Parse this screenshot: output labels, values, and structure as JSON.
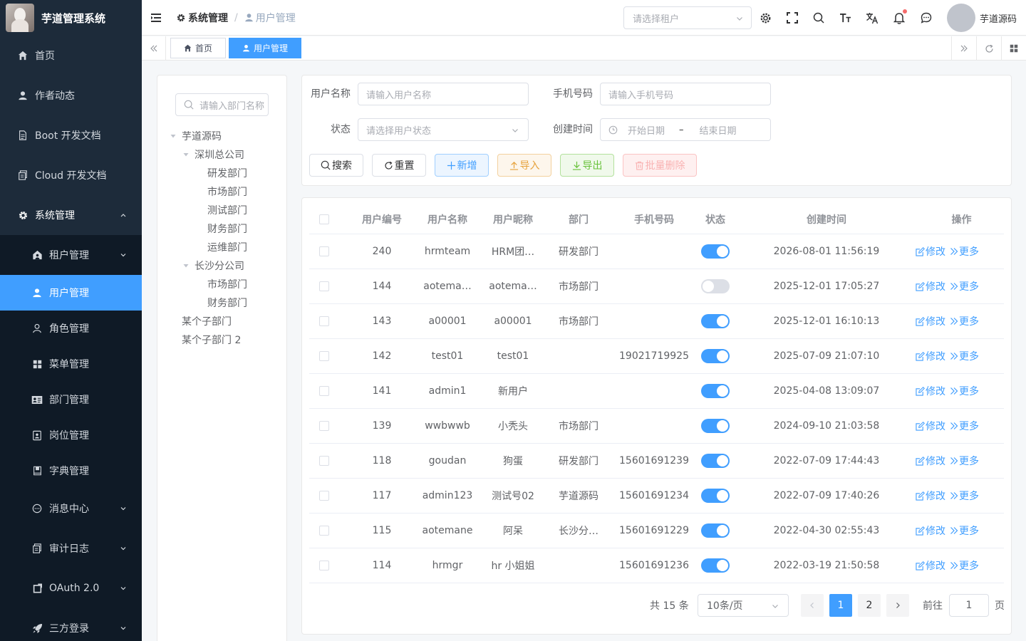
{
  "app": {
    "title": "芋道管理系统"
  },
  "sidebar": {
    "items": [
      {
        "label": "首页",
        "icon": "home-icon"
      },
      {
        "label": "作者动态",
        "icon": "user-icon"
      },
      {
        "label": "Boot 开发文档",
        "icon": "document-icon"
      },
      {
        "label": "Cloud 开发文档",
        "icon": "copy-document-icon"
      },
      {
        "label": "系统管理",
        "icon": "gear-icon",
        "expanded": true
      }
    ],
    "submenu": [
      {
        "label": "租户管理",
        "icon": "tenant-icon",
        "has_children": true
      },
      {
        "label": "用户管理",
        "icon": "user-icon",
        "active": true
      },
      {
        "label": "角色管理",
        "icon": "role-icon"
      },
      {
        "label": "菜单管理",
        "icon": "menu-grid-icon"
      },
      {
        "label": "部门管理",
        "icon": "dept-card-icon"
      },
      {
        "label": "岗位管理",
        "icon": "post-icon"
      },
      {
        "label": "字典管理",
        "icon": "dict-book-icon"
      },
      {
        "label": "消息中心",
        "icon": "message-icon",
        "has_children": true
      },
      {
        "label": "审计日志",
        "icon": "audit-log-icon",
        "has_children": true
      },
      {
        "label": "OAuth 2.0",
        "icon": "oauth-icon",
        "has_children": true
      },
      {
        "label": "三方登录",
        "icon": "rocket-icon",
        "has_children": true
      }
    ]
  },
  "header": {
    "breadcrumb": [
      "系统管理",
      "用户管理"
    ],
    "tenant_placeholder": "请选择租户",
    "user_name": "芋道源码"
  },
  "tags": [
    {
      "label": "首页",
      "icon": "home-icon"
    },
    {
      "label": "用户管理",
      "icon": "user-icon",
      "active": true
    }
  ],
  "dept_tree": {
    "search_placeholder": "请输入部门名称",
    "nodes": [
      {
        "label": "芋道源码",
        "level": 0,
        "expanded": true
      },
      {
        "label": "深圳总公司",
        "level": 1,
        "expanded": true
      },
      {
        "label": "研发部门",
        "level": 2
      },
      {
        "label": "市场部门",
        "level": 2
      },
      {
        "label": "测试部门",
        "level": 2
      },
      {
        "label": "财务部门",
        "level": 2
      },
      {
        "label": "运维部门",
        "level": 2
      },
      {
        "label": "长沙分公司",
        "level": 1,
        "expanded": true
      },
      {
        "label": "市场部门",
        "level": 2
      },
      {
        "label": "财务部门",
        "level": 2
      },
      {
        "label": "某个子部门",
        "level": 0
      },
      {
        "label": "某个子部门 2",
        "level": 0
      }
    ]
  },
  "search": {
    "username_label": "用户名称",
    "username_placeholder": "请输入用户名称",
    "mobile_label": "手机号码",
    "mobile_placeholder": "请输入手机号码",
    "status_label": "状态",
    "status_placeholder": "请选择用户状态",
    "create_time_label": "创建时间",
    "start_placeholder": "开始日期",
    "end_placeholder": "结束日期",
    "buttons": {
      "search": "搜索",
      "reset": "重置",
      "add": "新增",
      "import": "导入",
      "export": "导出",
      "batch_delete": "批量删除"
    }
  },
  "table": {
    "columns": [
      "用户编号",
      "用户名称",
      "用户昵称",
      "部门",
      "手机号码",
      "状态",
      "创建时间",
      "操作"
    ],
    "edit_label": "修改",
    "more_label": "更多",
    "rows": [
      {
        "id": "240",
        "username": "hrmteam",
        "nickname": "HRM团…",
        "dept": "研发部门",
        "mobile": "",
        "status": true,
        "create_time": "2026-08-01 11:56:19"
      },
      {
        "id": "144",
        "username": "aotema…",
        "nickname": "aotema…",
        "dept": "市场部门",
        "mobile": "",
        "status": false,
        "create_time": "2025-12-01 17:05:27"
      },
      {
        "id": "143",
        "username": "a00001",
        "nickname": "a00001",
        "dept": "市场部门",
        "mobile": "",
        "status": true,
        "create_time": "2025-12-01 16:10:13"
      },
      {
        "id": "142",
        "username": "test01",
        "nickname": "test01",
        "dept": "",
        "mobile": "19021719925",
        "status": true,
        "create_time": "2025-07-09 21:07:10"
      },
      {
        "id": "141",
        "username": "admin1",
        "nickname": "新用户",
        "dept": "",
        "mobile": "",
        "status": true,
        "create_time": "2025-04-08 13:09:07"
      },
      {
        "id": "139",
        "username": "wwbwwb",
        "nickname": "小秃头",
        "dept": "市场部门",
        "mobile": "",
        "status": true,
        "create_time": "2024-09-10 21:03:58"
      },
      {
        "id": "118",
        "username": "goudan",
        "nickname": "狗蛋",
        "dept": "研发部门",
        "mobile": "15601691239",
        "status": true,
        "create_time": "2022-07-09 17:44:43"
      },
      {
        "id": "117",
        "username": "admin123",
        "nickname": "测试号02",
        "dept": "芋道源码",
        "mobile": "15601691234",
        "status": true,
        "create_time": "2022-07-09 17:40:26"
      },
      {
        "id": "115",
        "username": "aotemane",
        "nickname": "阿呆",
        "dept": "长沙分…",
        "mobile": "15601691229",
        "status": true,
        "create_time": "2022-04-30 02:55:43"
      },
      {
        "id": "114",
        "username": "hrmgr",
        "nickname": "hr 小姐姐",
        "dept": "",
        "mobile": "15601691236",
        "status": true,
        "create_time": "2022-03-19 21:50:58"
      }
    ]
  },
  "pagination": {
    "total_text": "共 15 条",
    "page_size": "10条/页",
    "pages": [
      "1",
      "2"
    ],
    "current": "1",
    "goto_label": "前往",
    "goto_value": "1",
    "page_suffix": "页"
  }
}
